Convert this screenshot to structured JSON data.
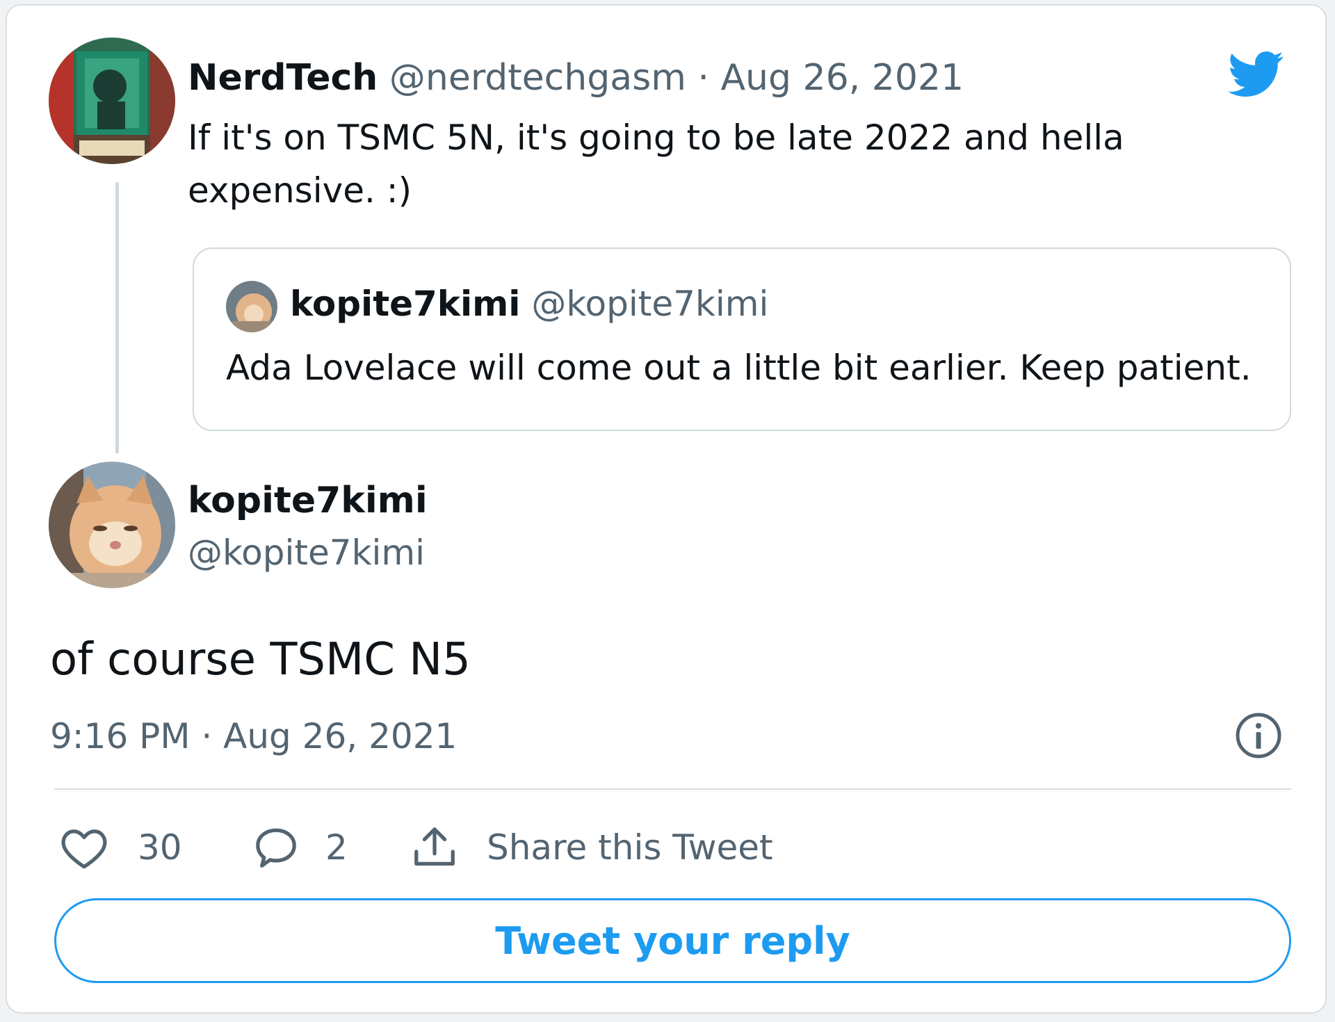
{
  "parent_tweet": {
    "display_name": "NerdTech",
    "handle": "@nerdtechgasm",
    "separator": "·",
    "date": "Aug 26, 2021",
    "text_line1": "If it's on TSMC 5N, it's going to be late 2022 and hella",
    "text_line2": "expensive. :)"
  },
  "quoted_tweet": {
    "display_name": "kopite7kimi",
    "handle": "@kopite7kimi",
    "text": "Ada Lovelace will come out a little bit earlier. Keep patient."
  },
  "main_tweet": {
    "display_name": "kopite7kimi",
    "handle": "@kopite7kimi",
    "text": "of course TSMC N5",
    "timestamp": "9:16 PM · Aug 26, 2021"
  },
  "actions": {
    "likes": "30",
    "replies": "2",
    "share_label": "Share this Tweet"
  },
  "reply_button_label": "Tweet your reply",
  "icons": {
    "brand": "twitter-bird-icon",
    "info": "info-icon",
    "like": "heart-icon",
    "reply": "reply-bubble-icon",
    "share": "share-icon"
  },
  "colors": {
    "accent": "#1d9bf0",
    "text": "#0f1419",
    "muted": "#536471",
    "border": "#cfd9de"
  }
}
